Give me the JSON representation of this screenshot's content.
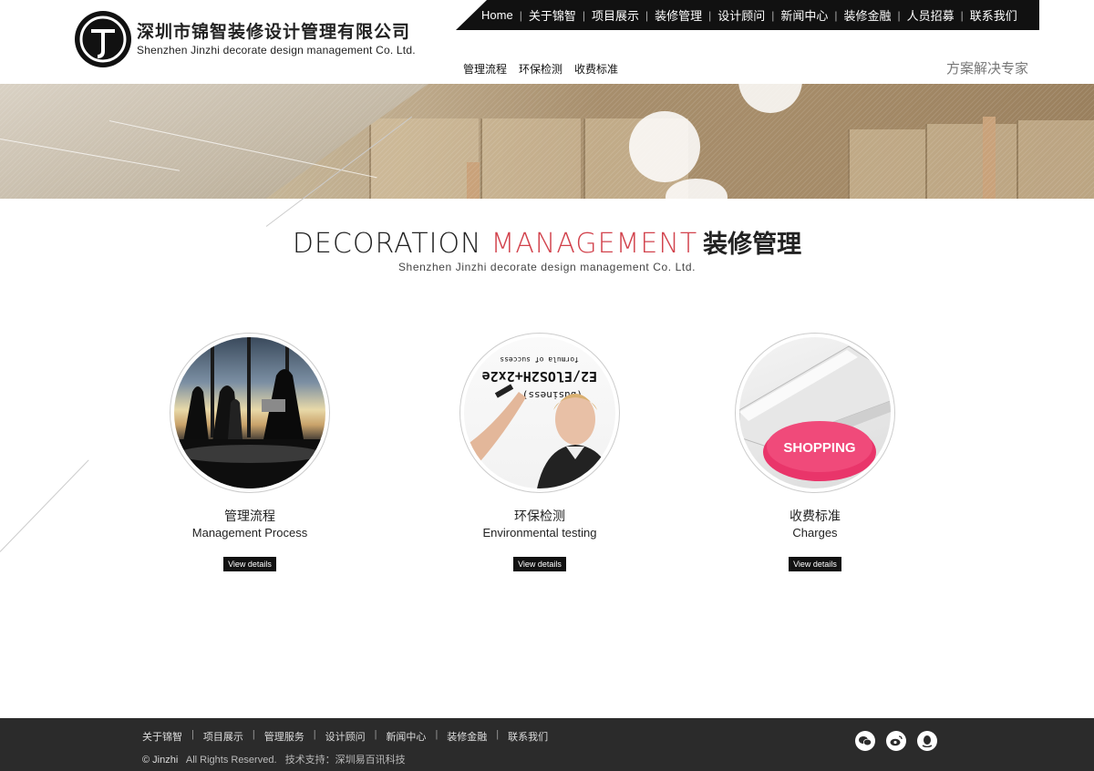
{
  "header": {
    "logo_cn": "深圳市锦智装修设计管理有限公司",
    "logo_en": "Shenzhen Jinzhi decorate design management Co. Ltd.",
    "topnav": [
      "Home",
      "关于锦智",
      "项目展示",
      "装修管理",
      "设计顾问",
      "新闻中心",
      "装修金融",
      "人员招募",
      "联系我们"
    ],
    "subnav": [
      "管理流程",
      "环保检测",
      "收费标准"
    ],
    "slogan": "方案解决专家"
  },
  "section": {
    "title_en_1": "DECORATION",
    "title_en_2": "MANAGEMENT",
    "title_cn": "装修管理",
    "subtitle": "Shenzhen Jinzhi decorate design management Co. Ltd."
  },
  "cards": [
    {
      "title_cn": "管理流程",
      "title_en": "Management Process",
      "button": "View details"
    },
    {
      "title_cn": "环保检测",
      "title_en": "Environmental testing",
      "button": "View details",
      "board_text": [
        "formula of success",
        "E2/ElOS2H+2x2e",
        "(business)"
      ]
    },
    {
      "title_cn": "收费标准",
      "title_en": "Charges",
      "button": "View details",
      "key_label": "SHOPPING"
    }
  ],
  "footer": {
    "nav": [
      "关于锦智",
      "项目展示",
      "管理服务",
      "设计顾问",
      "新闻中心",
      "装修金融",
      "联系我们"
    ],
    "brand": "© Jinzhi",
    "rights": "All Rights Reserved.",
    "support": "技术支持：深圳易百讯科技",
    "social": [
      "wechat-icon",
      "weibo-icon",
      "qq-icon"
    ]
  },
  "colors": {
    "accent": "#d2434d",
    "dark": "#111111",
    "footer_bg": "#2b2b2b"
  }
}
